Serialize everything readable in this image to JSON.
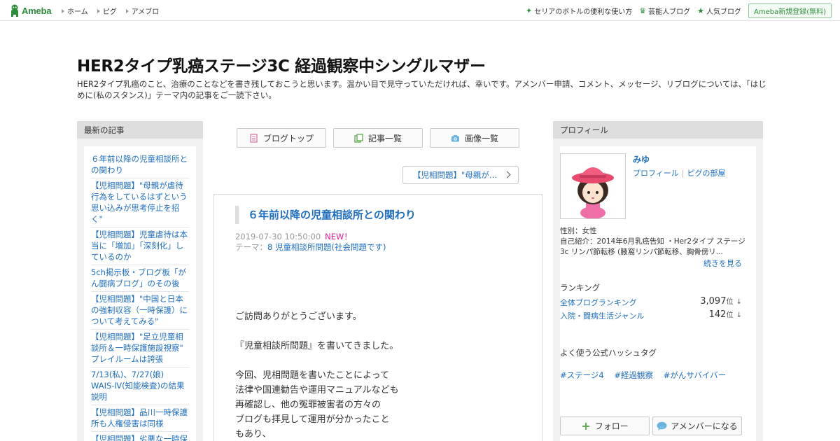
{
  "topbar": {
    "logo_text": "Ameba",
    "nav": [
      "ホーム",
      "ピグ",
      "アメブロ"
    ],
    "right_links": [
      {
        "icon": "sparkle-icon",
        "label": "セリアのボトルの便利な使い方"
      },
      {
        "icon": "crown-icon",
        "label": "芸能人ブログ"
      },
      {
        "icon": "star-icon",
        "label": "人気ブログ"
      }
    ],
    "signup_label": "Ameba新規登録(無料)",
    "brand_color": "#2d8c3c"
  },
  "blog": {
    "title": "HER2タイプ乳癌ステージ3C 経過観察中シングルマザー",
    "description": "HER2タイプ乳癌のこと、治療のことなどを書き残しておこうと思います。温かい目で見守っていただければ、幸いです。アメンバー申請、コメント、メッセージ、リブログについては、「はじめに(私のスタンス)」テーマ内の記事をご一読下さい。"
  },
  "recent": {
    "heading": "最新の記事",
    "entries": [
      "６年前以降の児童相談所との関わり",
      "【児相問題】\"母親が虐待行為をしているはずという思い込みが思考停止を招く\"",
      "【児相問題】児童虐待は本当に「増加」「深刻化」しているのか",
      "5ch掲示板・ブログ板「がん闘病ブログ」のその後",
      "【児相問題】\"中国と日本の強制収容（一時保護）について考えてみる\"",
      "【児相問題】\"足立児童相談所＆一時保護施設視察\" プレイルームは誇張",
      "7/13(私)、7/27(娘) WAIS-Ⅳ(知能検査)の結果説明",
      "【児相問題】品川一時保護所も人権侵害は同様",
      "【児相問題】劣悪な一時保護所"
    ]
  },
  "center": {
    "buttons": [
      {
        "icon": "document-icon",
        "label": "ブログトップ"
      },
      {
        "icon": "list-icon",
        "label": "記事一覧"
      },
      {
        "icon": "camera-icon",
        "label": "画像一覧"
      }
    ],
    "prev_link": "【児相問題】\"母親が…",
    "article": {
      "title": "６年前以降の児童相談所との関わり",
      "date": "2019-07-30 10:50:00",
      "new_badge": "NEW！",
      "theme_label": "テーマ：",
      "theme": "8 児童相談所問題(社会問題です)",
      "paragraphs": [
        [
          "ご訪問ありがとうございます。"
        ],
        [
          "『児童相談所問題』を書いてきました。"
        ],
        [
          "今回、児相問題を書いたことによって",
          "法律や国連勧告や運用マニュアルなども",
          "再確認し、他の冤罪被害者の方々の",
          "ブログも拝見して運用が分かったこと",
          "もあり、"
        ]
      ]
    }
  },
  "profile": {
    "heading": "プロフィール",
    "name": "みゆ",
    "link_profile": "プロフィール",
    "link_pig": "ピグの部屋",
    "sex": "性別：女性",
    "intro": "自己紹介：2014年6月乳癌告知 ・Her2タイプ ステージ3c リンパ節転移 (腋窩リンパ節転移、胸骨傍リ...",
    "more": "続きを見る",
    "ranking_title": "ランキング",
    "rankings": [
      {
        "label": "全体ブログランキング",
        "value": "3,097",
        "unit": "位",
        "arrow": "↓"
      },
      {
        "label": "入院・闘病生活ジャンル",
        "value": "142",
        "unit": "位",
        "arrow": "↓"
      }
    ],
    "hashtag_title": "よく使う公式ハッシュタグ",
    "hashtags": [
      "#ステージ4",
      "#経過観察",
      "#がんサバイバー"
    ],
    "follow_label": "フォロー",
    "amember_label": "アメンバーになる"
  }
}
